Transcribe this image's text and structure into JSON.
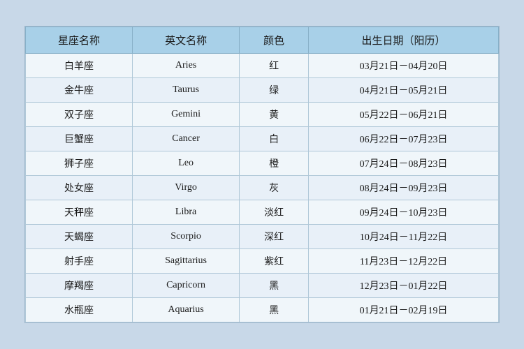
{
  "table": {
    "headers": [
      {
        "key": "chinese_name",
        "label": "星座名称"
      },
      {
        "key": "english_name",
        "label": "英文名称"
      },
      {
        "key": "color",
        "label": "颜色"
      },
      {
        "key": "birth_date",
        "label": "出生日期（阳历）"
      }
    ],
    "rows": [
      {
        "chinese_name": "白羊座",
        "english_name": "Aries",
        "color": "红",
        "birth_date": "03月21日－04月20日"
      },
      {
        "chinese_name": "金牛座",
        "english_name": "Taurus",
        "color": "绿",
        "birth_date": "04月21日－05月21日"
      },
      {
        "chinese_name": "双子座",
        "english_name": "Gemini",
        "color": "黄",
        "birth_date": "05月22日－06月21日"
      },
      {
        "chinese_name": "巨蟹座",
        "english_name": "Cancer",
        "color": "白",
        "birth_date": "06月22日－07月23日"
      },
      {
        "chinese_name": "狮子座",
        "english_name": "Leo",
        "color": "橙",
        "birth_date": "07月24日－08月23日"
      },
      {
        "chinese_name": "处女座",
        "english_name": "Virgo",
        "color": "灰",
        "birth_date": "08月24日－09月23日"
      },
      {
        "chinese_name": "天秤座",
        "english_name": "Libra",
        "color": "淡红",
        "birth_date": "09月24日－10月23日"
      },
      {
        "chinese_name": "天蝎座",
        "english_name": "Scorpio",
        "color": "深红",
        "birth_date": "10月24日－11月22日"
      },
      {
        "chinese_name": "射手座",
        "english_name": "Sagittarius",
        "color": "紫红",
        "birth_date": "11月23日－12月22日"
      },
      {
        "chinese_name": "摩羯座",
        "english_name": "Capricorn",
        "color": "黑",
        "birth_date": "12月23日－01月22日"
      },
      {
        "chinese_name": "水瓶座",
        "english_name": "Aquarius",
        "color": "黑",
        "birth_date": "01月21日－02月19日"
      }
    ]
  }
}
